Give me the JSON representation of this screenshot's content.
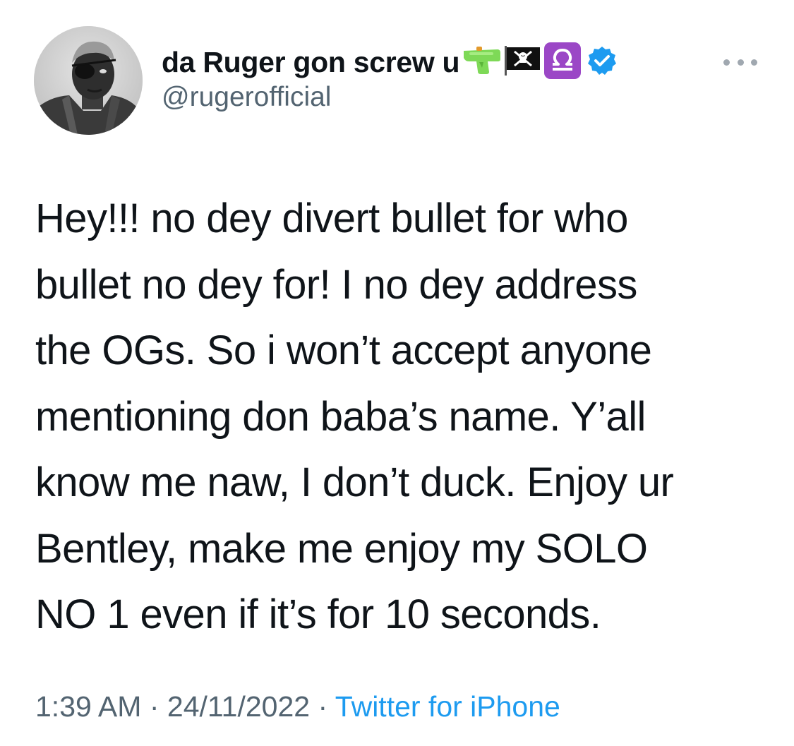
{
  "author": {
    "display_name": "da Ruger gon screw u",
    "handle": "@rugerofficial",
    "verified": true,
    "name_emoji": [
      "water-pistol-icon",
      "pirate-flag-icon",
      "libra-icon"
    ],
    "avatar": "profile-photo"
  },
  "tweet": {
    "text": "Hey!!! no dey divert bullet for who\nbullet no dey for! I no dey address\nthe OGs. So i won’t accept anyone\nmentioning don baba’s name. Y’all\nknow me naw, I don’t duck. Enjoy ur\nBentley, make me enjoy my SOLO\nNO 1 even if it’s for 10 seconds.",
    "time": "1:39 AM",
    "separator": "·",
    "date": "24/11/2022",
    "source": "Twitter for iPhone"
  },
  "colors": {
    "text": "#0f1419",
    "secondary": "#536471",
    "accent": "#1d9bf0",
    "libra_bg": "#9b47c6"
  }
}
